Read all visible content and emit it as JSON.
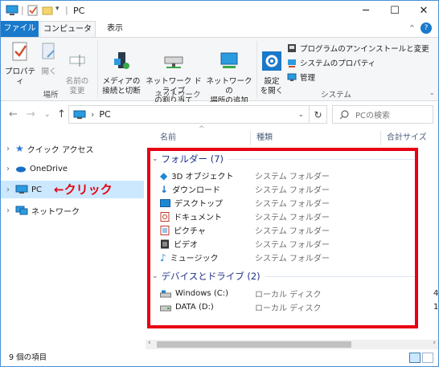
{
  "window": {
    "title": "PC"
  },
  "tabs": {
    "file": "ファイル",
    "computer": "コンピューター",
    "view": "表示"
  },
  "ribbon": {
    "location": {
      "group_label": "場所",
      "properties": "プロパティ",
      "open": "開く",
      "rename": "名前の\n変更"
    },
    "network": {
      "group_label": "ネットワーク",
      "media": "メディアの\n接続と切断",
      "map_drive": "ネットワーク ドライブ\nの割り当て",
      "add_location": "ネットワークの\n場所の追加"
    },
    "system": {
      "group_label": "システム",
      "settings": "設定\nを開く",
      "uninstall": "プログラムのアンインストールと変更",
      "system_props": "システムのプロパティ",
      "manage": "管理"
    }
  },
  "address": {
    "path_item": "PC",
    "search_placeholder": "PCの検索"
  },
  "nav": {
    "quick_access": "クイック アクセス",
    "onedrive": "OneDrive",
    "pc": "PC",
    "network": "ネットワーク",
    "annotation": "←クリック"
  },
  "columns": {
    "name": "名前",
    "type": "種類",
    "size": "合計サイズ"
  },
  "groups": {
    "folders": "フォルダー (7)",
    "devices": "デバイスとドライブ (2)"
  },
  "folders": [
    {
      "name": "3D オブジェクト",
      "type": "システム フォルダー",
      "icon": "cube-3d-icon"
    },
    {
      "name": "ダウンロード",
      "type": "システム フォルダー",
      "icon": "download-arrow-icon"
    },
    {
      "name": "デスクトップ",
      "type": "システム フォルダー",
      "icon": "desktop-icon"
    },
    {
      "name": "ドキュメント",
      "type": "システム フォルダー",
      "icon": "document-icon"
    },
    {
      "name": "ピクチャ",
      "type": "システム フォルダー",
      "icon": "pictures-icon"
    },
    {
      "name": "ビデオ",
      "type": "システム フォルダー",
      "icon": "video-icon"
    },
    {
      "name": "ミュージック",
      "type": "システム フォルダー",
      "icon": "music-icon"
    }
  ],
  "drives": [
    {
      "name": "Windows (C:)",
      "type": "ローカル ディスク",
      "size": "4"
    },
    {
      "name": "DATA (D:)",
      "type": "ローカル ディスク",
      "size": "1."
    }
  ],
  "status": {
    "count": "9 個の項目"
  },
  "colors": {
    "accent": "#1979ca",
    "highlight_red": "#e60012",
    "selection": "#cce8ff"
  }
}
